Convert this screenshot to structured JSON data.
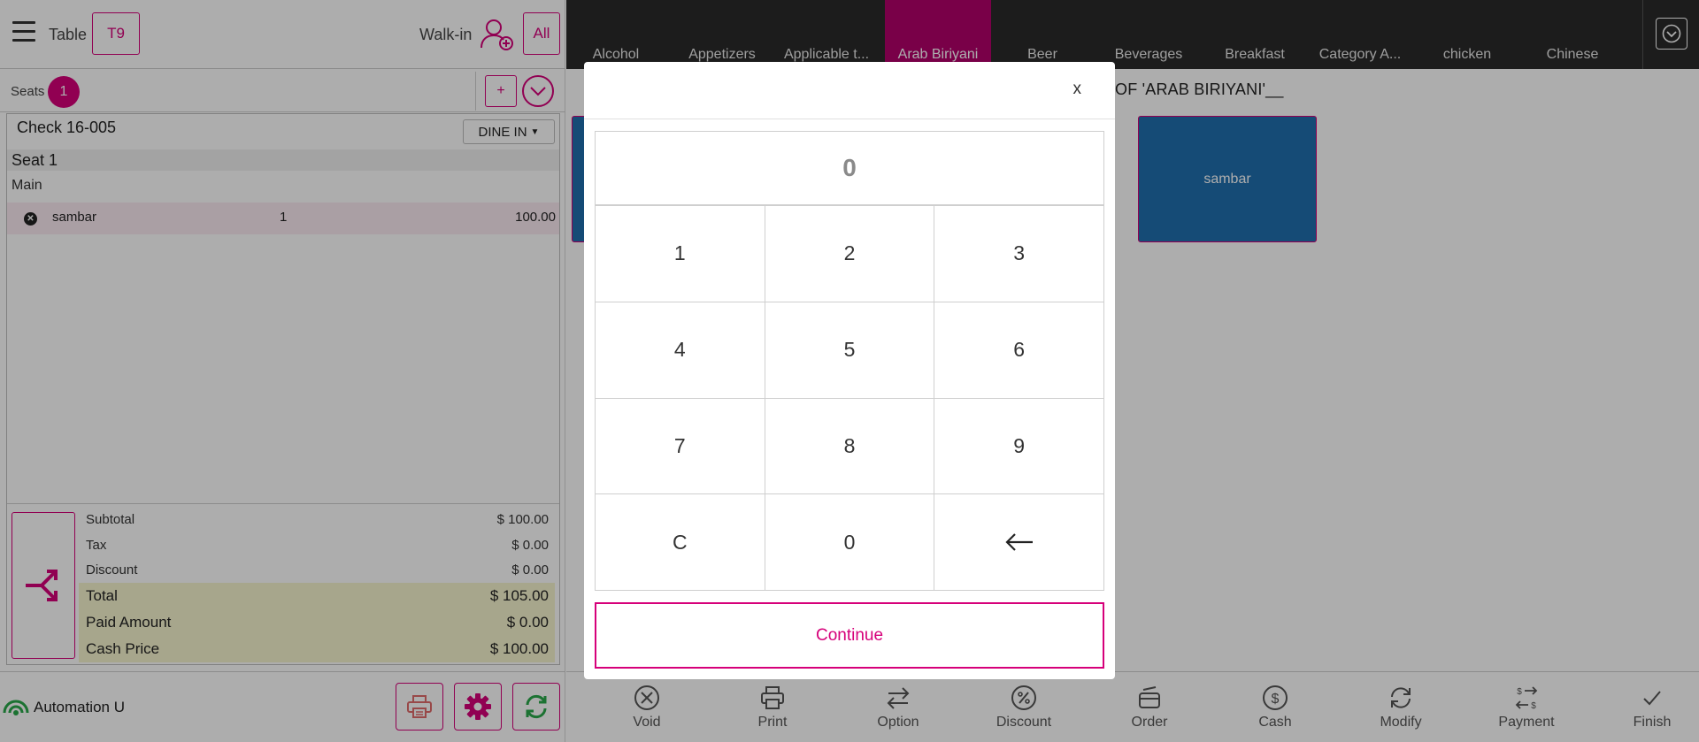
{
  "header": {
    "table_label": "Table",
    "table_value": "T9",
    "walkin_label": "Walk-in",
    "all_label": "All"
  },
  "seats": {
    "label": "Seats",
    "count": "1",
    "add_label": "+"
  },
  "check": {
    "title": "Check 16-005",
    "order_type": "DINE IN",
    "seat_label": "Seat 1",
    "course_label": "Main",
    "items": [
      {
        "name": "sambar",
        "qty": "1",
        "price": "100.00"
      }
    ]
  },
  "totals": {
    "subtotal_label": "Subtotal",
    "subtotal": "$ 100.00",
    "tax_label": "Tax",
    "tax": "$ 0.00",
    "discount_label": "Discount",
    "discount": "$ 0.00",
    "total_label": "Total",
    "total": "$ 105.00",
    "paid_label": "Paid Amount",
    "paid": "$ 0.00",
    "cash_label": "Cash Price",
    "cash": "$ 100.00"
  },
  "footer": {
    "user_name": "Automation U"
  },
  "categories": {
    "items": [
      "Alcohol",
      "Appetizers",
      "Applicable t...",
      "Arab Biriyani",
      "Beer",
      "Beverages",
      "Breakfast",
      "Category A...",
      "chicken",
      "Chinese"
    ],
    "active": "Arab Biriyani"
  },
  "menu": {
    "breadcrumb": "OF 'ARAB BIRIYANI'__",
    "tiles": [
      "sambar"
    ]
  },
  "actions": {
    "void": "Void",
    "print": "Print",
    "option": "Option",
    "discount": "Discount",
    "order": "Order",
    "cash": "Cash",
    "modify": "Modify",
    "payment": "Payment",
    "finish": "Finish"
  },
  "keypad_modal": {
    "close_label": "x",
    "display_value": "0",
    "keys": [
      "1",
      "2",
      "3",
      "4",
      "5",
      "6",
      "7",
      "8",
      "9",
      "C",
      "0"
    ],
    "continue_label": "Continue"
  },
  "colors": {
    "accent": "#d6007a",
    "active_category": "#b3006b",
    "category_bar": "#2a2a2a",
    "tile": "#1f6fae",
    "refresh": "#2aa84a",
    "totals_highlight": "#f7f5cf",
    "item_highlight": "#fbeaf2"
  },
  "icons": {
    "menu": "hamburger-icon",
    "walkin": "add-user-icon",
    "split": "split-arrows-icon",
    "printer": "printer-icon",
    "settings": "gear-icon",
    "refresh": "refresh-icon",
    "user": "wifi-signal-icon",
    "backspace": "arrow-left-icon"
  }
}
